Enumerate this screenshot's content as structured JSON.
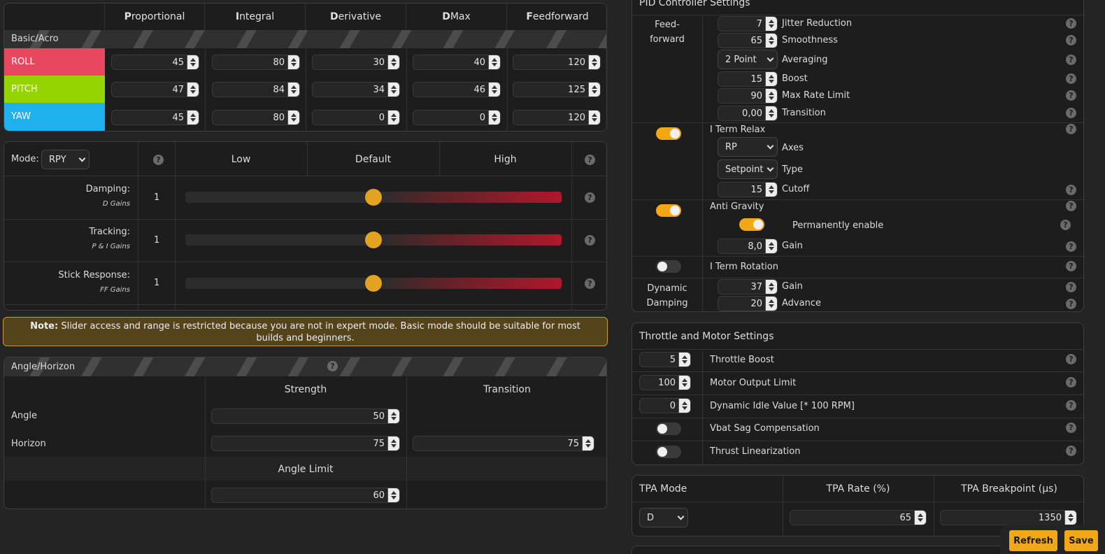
{
  "colors": {
    "accent": "#f2a814",
    "roll": "#e8485f",
    "pitch": "#95d400",
    "yaw": "#1fb0ee"
  },
  "pid": {
    "headers": [
      {
        "first": "P",
        "rest": "roportional"
      },
      {
        "first": "I",
        "rest": "ntegral"
      },
      {
        "first": "D",
        "rest": "erivative"
      },
      {
        "first": "D",
        "rest": " Max"
      },
      {
        "first": "F",
        "rest": "eedforward"
      }
    ],
    "section_label": "Basic/Acro",
    "rows": [
      {
        "name": "ROLL",
        "values": [
          "45",
          "80",
          "30",
          "40",
          "120"
        ]
      },
      {
        "name": "PITCH",
        "values": [
          "47",
          "84",
          "34",
          "46",
          "125"
        ]
      },
      {
        "name": "YAW",
        "values": [
          "45",
          "80",
          "0",
          "0",
          "120"
        ]
      }
    ]
  },
  "sliders": {
    "mode_label": "Mode:",
    "mode_value": "RPY",
    "cols": [
      "Low",
      "Default",
      "High"
    ],
    "rows": [
      {
        "label": "Damping:",
        "sub": "D Gains",
        "value": "1",
        "level": 0.5
      },
      {
        "label": "Tracking:",
        "sub": "P & I Gains",
        "value": "1",
        "level": 0.5
      },
      {
        "label": "Stick Response:",
        "sub": "FF Gains",
        "value": "1",
        "level": 0.5
      }
    ]
  },
  "note": {
    "bold": "Note:",
    "text": " Slider access and range is restricted because you are not in expert mode. Basic mode should be suitable for most builds and beginners."
  },
  "angle": {
    "title": "Angle/Horizon",
    "cols": [
      "Strength",
      "Transition"
    ],
    "angle_label": "Angle",
    "angle_strength": "50",
    "horizon_label": "Horizon",
    "horizon_strength": "75",
    "horizon_transition": "75",
    "limit_label": "Angle Limit",
    "limit_value": "60"
  },
  "pidctrl": {
    "title": "PID Controller Settings",
    "ff_label1": "Feed-",
    "ff_label2": "forward",
    "ff": [
      {
        "v": "7",
        "l": "Jitter Reduction"
      },
      {
        "v": "65",
        "l": "Smoothness"
      },
      {
        "sel": "2 Point",
        "l": "Averaging"
      },
      {
        "v": "15",
        "l": "Boost"
      },
      {
        "v": "90",
        "l": "Max Rate Limit"
      },
      {
        "v": "0,00",
        "l": "Transition"
      }
    ],
    "iterm_relax": {
      "label": "I Term Relax",
      "axes_sel": "RP",
      "axes_l": "Axes",
      "type_sel": "Setpoint",
      "type_l": "Type",
      "cutoff_v": "15",
      "cutoff_l": "Cutoff"
    },
    "anti_gravity": {
      "label": "Anti Gravity",
      "perm": "Permanently enable",
      "gain_v": "8,0",
      "gain_l": "Gain"
    },
    "iterm_rotation": "I Term Rotation",
    "dyn": {
      "label1": "Dynamic",
      "label2": "Damping",
      "gain_v": "37",
      "gain_l": "Gain",
      "adv_v": "20",
      "adv_l": "Advance"
    }
  },
  "throttle": {
    "title": "Throttle and Motor Settings",
    "rows": [
      {
        "v": "5",
        "l": "Throttle Boost"
      },
      {
        "v": "100",
        "l": "Motor Output Limit"
      },
      {
        "v": "0",
        "l": "Dynamic Idle Value [* 100 RPM]"
      },
      {
        "l": "Vbat Sag Compensation"
      },
      {
        "l": "Thrust Linearization"
      }
    ]
  },
  "tpa": {
    "mode_h": "TPA Mode",
    "rate_h": "TPA Rate (%)",
    "bp_h": "TPA Breakpoint (µs)",
    "mode_v": "D",
    "rate_v": "65",
    "bp_v": "1350"
  },
  "buttons": {
    "refresh": "Refresh",
    "save": "Save"
  }
}
